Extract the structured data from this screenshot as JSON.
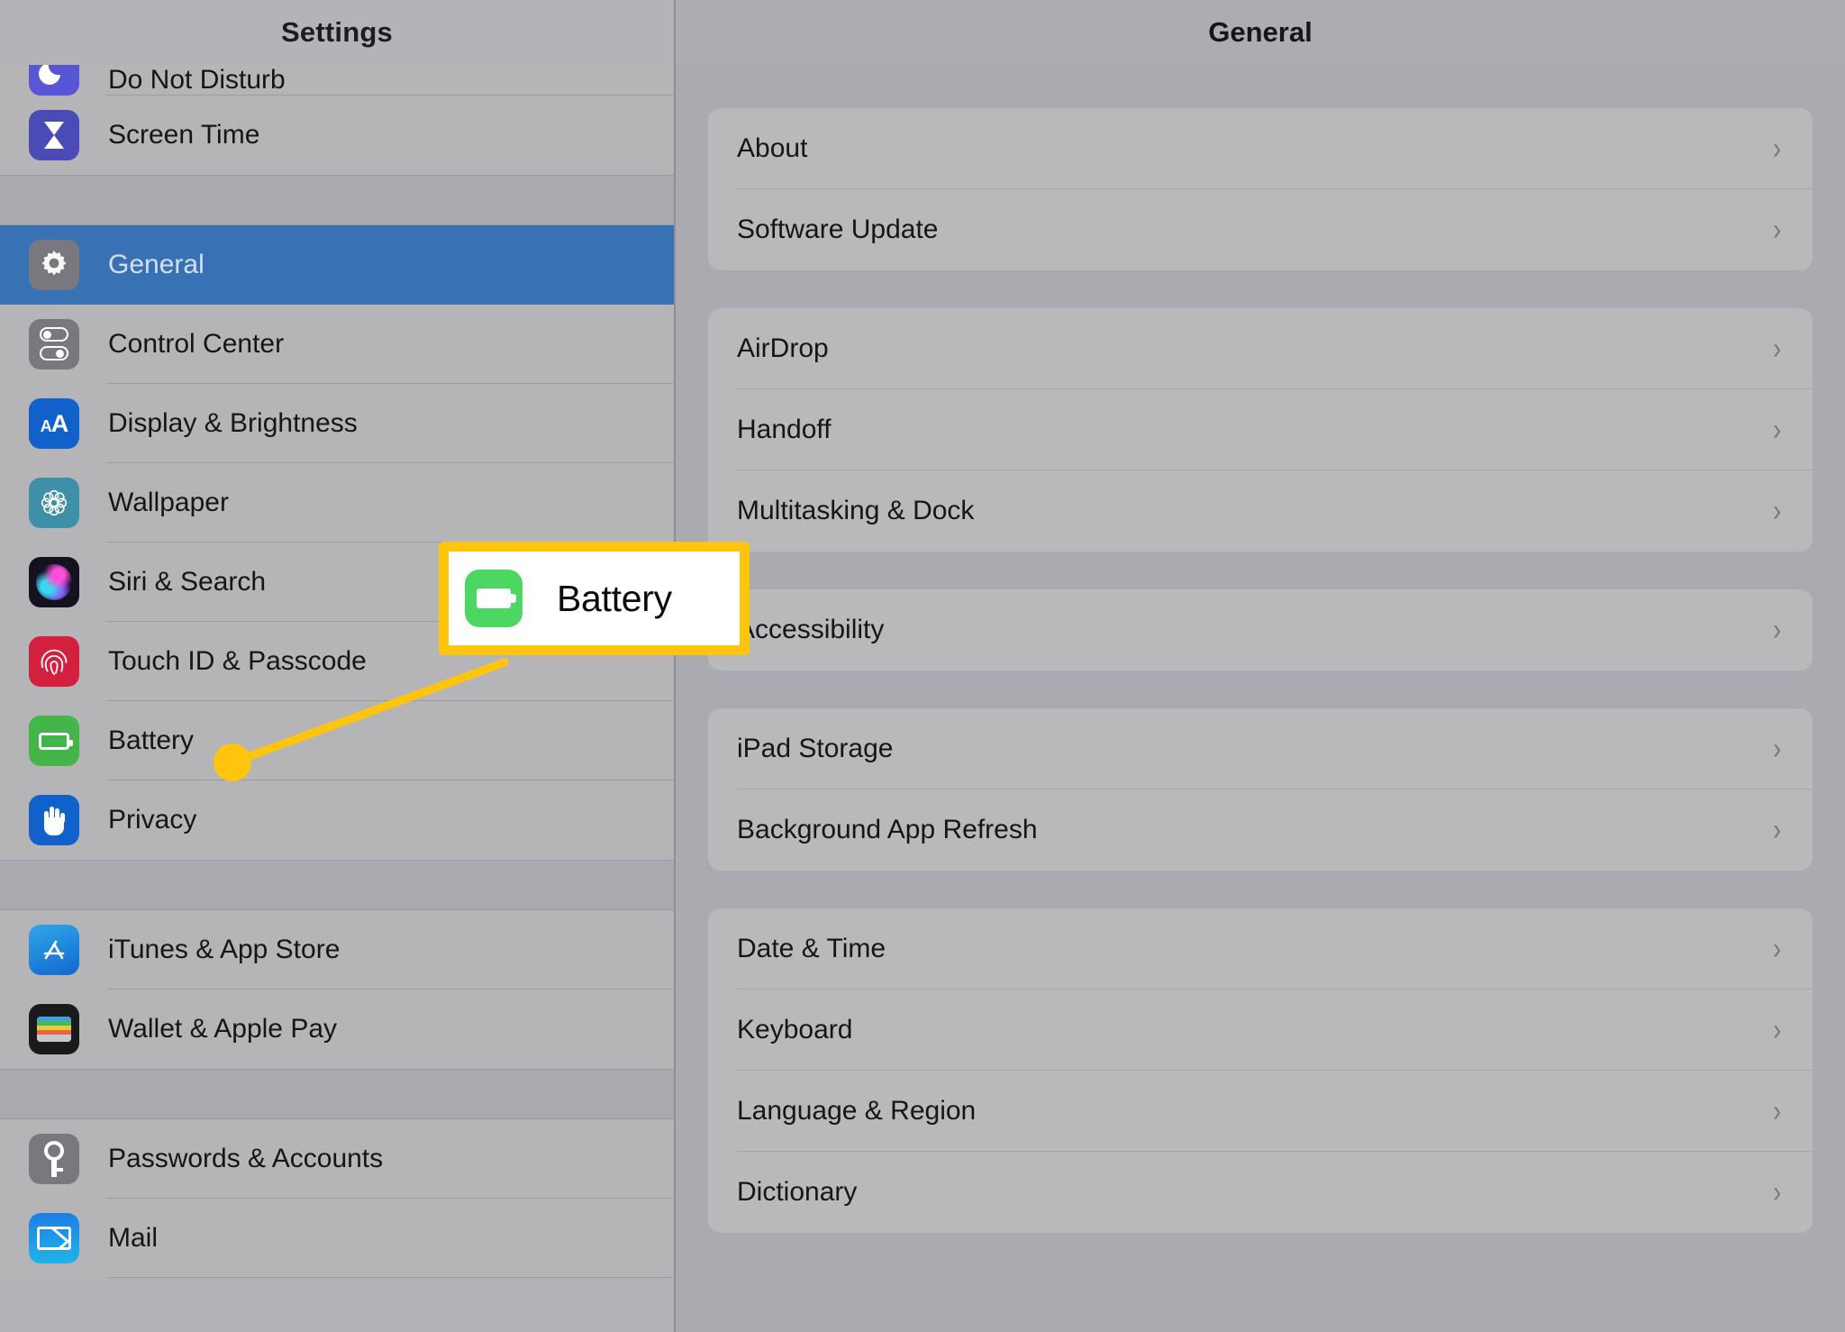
{
  "sidebar": {
    "title": "Settings",
    "groups": [
      {
        "rows": [
          {
            "label": "Do Not Disturb",
            "icon": "moon-icon",
            "icon_class": "ic-dnd",
            "clipped": true
          },
          {
            "label": "Screen Time",
            "icon": "hourglass-icon",
            "icon_class": "ic-screen",
            "clipped": false
          }
        ]
      },
      {
        "rows": [
          {
            "label": "General",
            "icon": "gear-icon",
            "icon_class": "ic-general",
            "selected": true
          },
          {
            "label": "Control Center",
            "icon": "toggles-icon",
            "icon_class": "ic-control"
          },
          {
            "label": "Display & Brightness",
            "icon": "text-size-icon",
            "icon_class": "ic-display"
          },
          {
            "label": "Wallpaper",
            "icon": "flower-icon",
            "icon_class": "ic-wall"
          },
          {
            "label": "Siri & Search",
            "icon": "siri-orb-icon",
            "icon_class": "ic-siri"
          },
          {
            "label": "Touch ID & Passcode",
            "icon": "fingerprint-icon",
            "icon_class": "ic-touch"
          },
          {
            "label": "Battery",
            "icon": "battery-icon",
            "icon_class": "ic-battery"
          },
          {
            "label": "Privacy",
            "icon": "hand-icon",
            "icon_class": "ic-privacy"
          }
        ]
      },
      {
        "rows": [
          {
            "label": "iTunes & App Store",
            "icon": "app-store-icon",
            "icon_class": "ic-itunes"
          },
          {
            "label": "Wallet & Apple Pay",
            "icon": "wallet-icon",
            "icon_class": "ic-wallet"
          }
        ]
      },
      {
        "rows": [
          {
            "label": "Passwords & Accounts",
            "icon": "key-icon",
            "icon_class": "ic-pass"
          },
          {
            "label": "Mail",
            "icon": "envelope-icon",
            "icon_class": "ic-mail"
          }
        ]
      }
    ]
  },
  "detail": {
    "title": "General",
    "chevron": "›",
    "cards": [
      {
        "rows": [
          {
            "label": "About"
          },
          {
            "label": "Software Update"
          }
        ]
      },
      {
        "rows": [
          {
            "label": "AirDrop"
          },
          {
            "label": "Handoff"
          },
          {
            "label": "Multitasking & Dock"
          }
        ]
      },
      {
        "rows": [
          {
            "label": "Accessibility"
          }
        ]
      },
      {
        "rows": [
          {
            "label": "iPad Storage"
          },
          {
            "label": "Background App Refresh"
          }
        ]
      },
      {
        "rows": [
          {
            "label": "Date & Time"
          },
          {
            "label": "Keyboard"
          },
          {
            "label": "Language & Region"
          },
          {
            "label": "Dictionary"
          }
        ]
      }
    ]
  },
  "callout": {
    "label": "Battery",
    "icon": "battery-icon",
    "border_color": "#ffc40c",
    "fill_color": "#ffffff",
    "icon_color": "#4bd762",
    "leader_color": "#ffc40c"
  }
}
